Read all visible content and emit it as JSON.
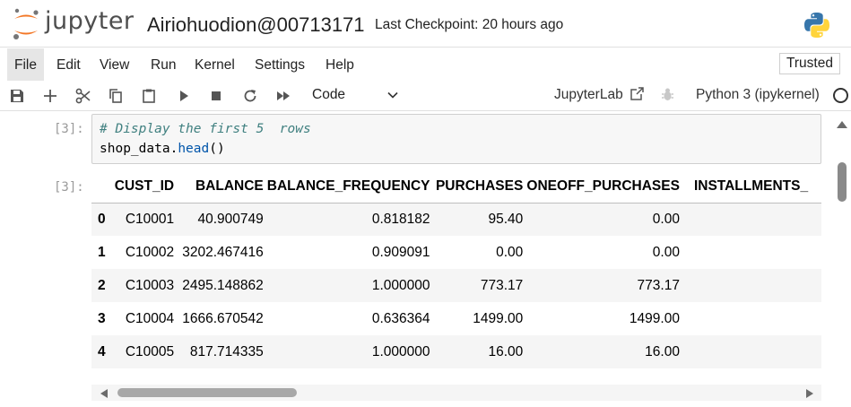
{
  "header": {
    "logo_text": "jupyter",
    "notebook_title": "Airiohuodion@00713171",
    "checkpoint": "Last Checkpoint: 20 hours ago"
  },
  "menu": [
    "File",
    "Edit",
    "View",
    "Run",
    "Kernel",
    "Settings",
    "Help"
  ],
  "trusted_label": "Trusted",
  "toolbar": {
    "cell_type": "Code",
    "jupyterlab_label": "JupyterLab",
    "kernel_name": "Python 3 (ipykernel)"
  },
  "cell": {
    "in_prompt": "[3]:",
    "out_prompt": "[3]:",
    "code_comment": "# Display the first 5  rows",
    "code_obj": "shop_data.",
    "code_fn": "head",
    "code_args": "()"
  },
  "dataframe": {
    "columns": [
      "",
      "CUST_ID",
      "BALANCE",
      "BALANCE_FREQUENCY",
      "PURCHASES",
      "ONEOFF_PURCHASES",
      "INSTALLMENTS_"
    ],
    "rows": [
      [
        "0",
        "C10001",
        "40.900749",
        "0.818182",
        "95.40",
        "0.00",
        ""
      ],
      [
        "1",
        "C10002",
        "3202.467416",
        "0.909091",
        "0.00",
        "0.00",
        ""
      ],
      [
        "2",
        "C10003",
        "2495.148862",
        "1.000000",
        "773.17",
        "773.17",
        ""
      ],
      [
        "3",
        "C10004",
        "1666.670542",
        "0.636364",
        "1499.00",
        "1499.00",
        ""
      ],
      [
        "4",
        "C10005",
        "817.714335",
        "1.000000",
        "16.00",
        "16.00",
        ""
      ]
    ]
  },
  "colors": {
    "comment": "#408080",
    "function": "#0055aa",
    "logo_orange": "#f37726",
    "python_blue": "#3776ab",
    "python_yellow": "#ffd43b"
  }
}
